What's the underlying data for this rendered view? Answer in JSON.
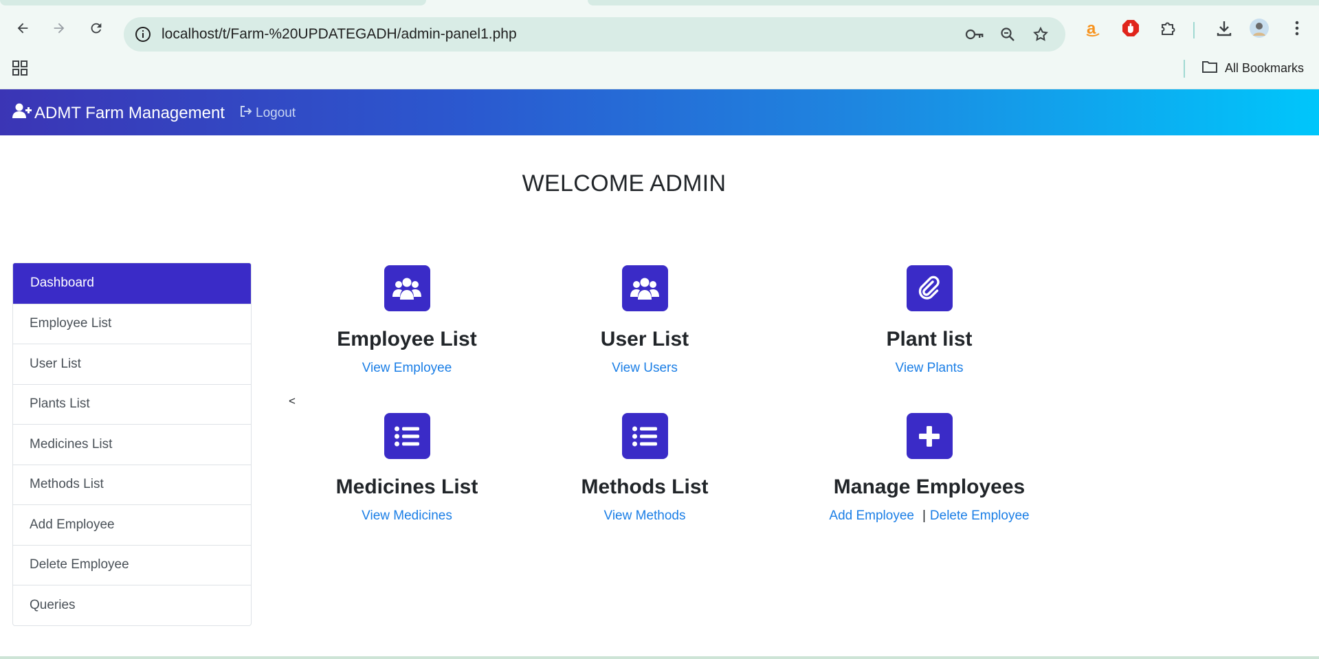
{
  "browser": {
    "url": "localhost/t/Farm-%20UPDATEGADH/admin-panel1.php",
    "bookmarks_label": "All Bookmarks"
  },
  "navbar": {
    "brand": "ADMT Farm Management",
    "logout": "Logout"
  },
  "welcome": "WELCOME ADMIN",
  "sidebar": {
    "items": [
      {
        "label": "Dashboard"
      },
      {
        "label": "Employee List"
      },
      {
        "label": "User List"
      },
      {
        "label": "Plants List"
      },
      {
        "label": "Medicines List"
      },
      {
        "label": "Methods List"
      },
      {
        "label": "Add Employee"
      },
      {
        "label": "Delete Employee"
      },
      {
        "label": "Queries"
      }
    ]
  },
  "collapse_toggle": "<",
  "cards": [
    {
      "title": "Employee List",
      "link": "View Employee",
      "icon": "users-icon"
    },
    {
      "title": "User List",
      "link": "View Users",
      "icon": "users-icon"
    },
    {
      "title": "Plant list",
      "link": "View Plants",
      "icon": "paperclip-icon"
    },
    {
      "title": "Medicines List",
      "link": "View Medicines",
      "icon": "list-icon"
    },
    {
      "title": "Methods List",
      "link": "View Methods",
      "icon": "list-icon"
    },
    {
      "title": "Manage Employees",
      "links": [
        "Add Employee",
        "Delete Employee"
      ],
      "separator": "|",
      "icon": "plus-icon"
    }
  ],
  "colors": {
    "accent": "#3a2bc7",
    "link": "#1a7ee6",
    "navbar_start": "#3b35b5",
    "navbar_end": "#00c6fb"
  }
}
